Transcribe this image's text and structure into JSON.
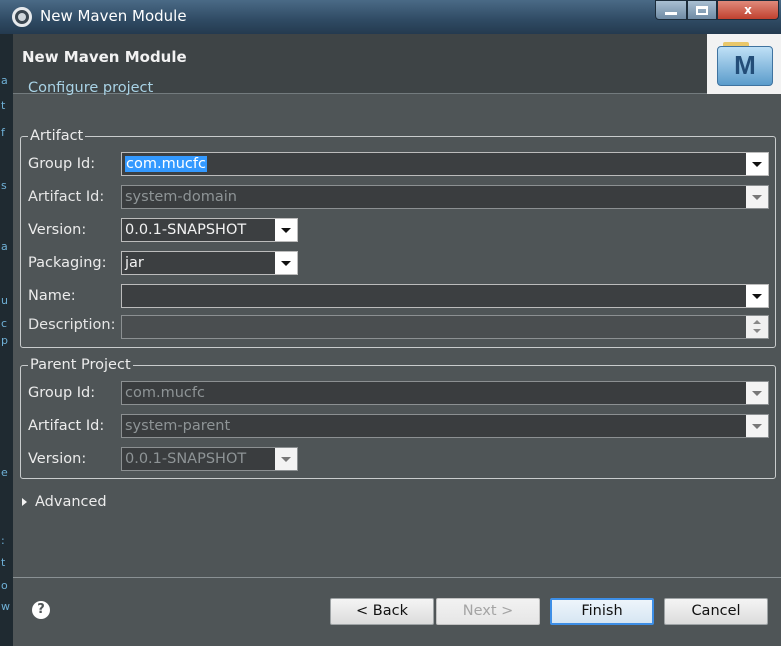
{
  "window": {
    "title": "New Maven Module",
    "controls": {
      "minimize": "minimize-icon",
      "maximize": "maximize-icon",
      "close_label": "x"
    }
  },
  "header": {
    "title": "New Maven Module",
    "subtitle": "Configure project",
    "logo_letter": "M"
  },
  "artifact": {
    "group_title": "Artifact",
    "group_id": {
      "label": "Group Id:",
      "value": "com.mucfc"
    },
    "artifact_id": {
      "label": "Artifact Id:",
      "value": "system-domain"
    },
    "version": {
      "label": "Version:",
      "value": "0.0.1-SNAPSHOT"
    },
    "packaging": {
      "label": "Packaging:",
      "value": "jar"
    },
    "name": {
      "label": "Name:",
      "value": ""
    },
    "description": {
      "label": "Description:",
      "value": ""
    }
  },
  "parent": {
    "group_title": "Parent Project",
    "group_id": {
      "label": "Group Id:",
      "value": "com.mucfc"
    },
    "artifact_id": {
      "label": "Artifact Id:",
      "value": "system-parent"
    },
    "version": {
      "label": "Version:",
      "value": "0.0.1-SNAPSHOT"
    }
  },
  "advanced": {
    "label": "Advanced"
  },
  "footer": {
    "help_label": "?",
    "back_label": "< Back",
    "next_label": "Next >",
    "finish_label": "Finish",
    "cancel_label": "Cancel"
  },
  "background_editor": {
    "fragments": [
      "a",
      "t",
      "f",
      "s",
      "a",
      "u",
      "c",
      "p",
      "e",
      ":",
      "t",
      "o",
      "w"
    ]
  },
  "colors": {
    "dialog_bg": "#4f5557",
    "banner_bg": "#3e4446",
    "selection": "#3399ff",
    "subtitle": "#a9d3e6",
    "default_button_border": "#3d8ee6"
  }
}
